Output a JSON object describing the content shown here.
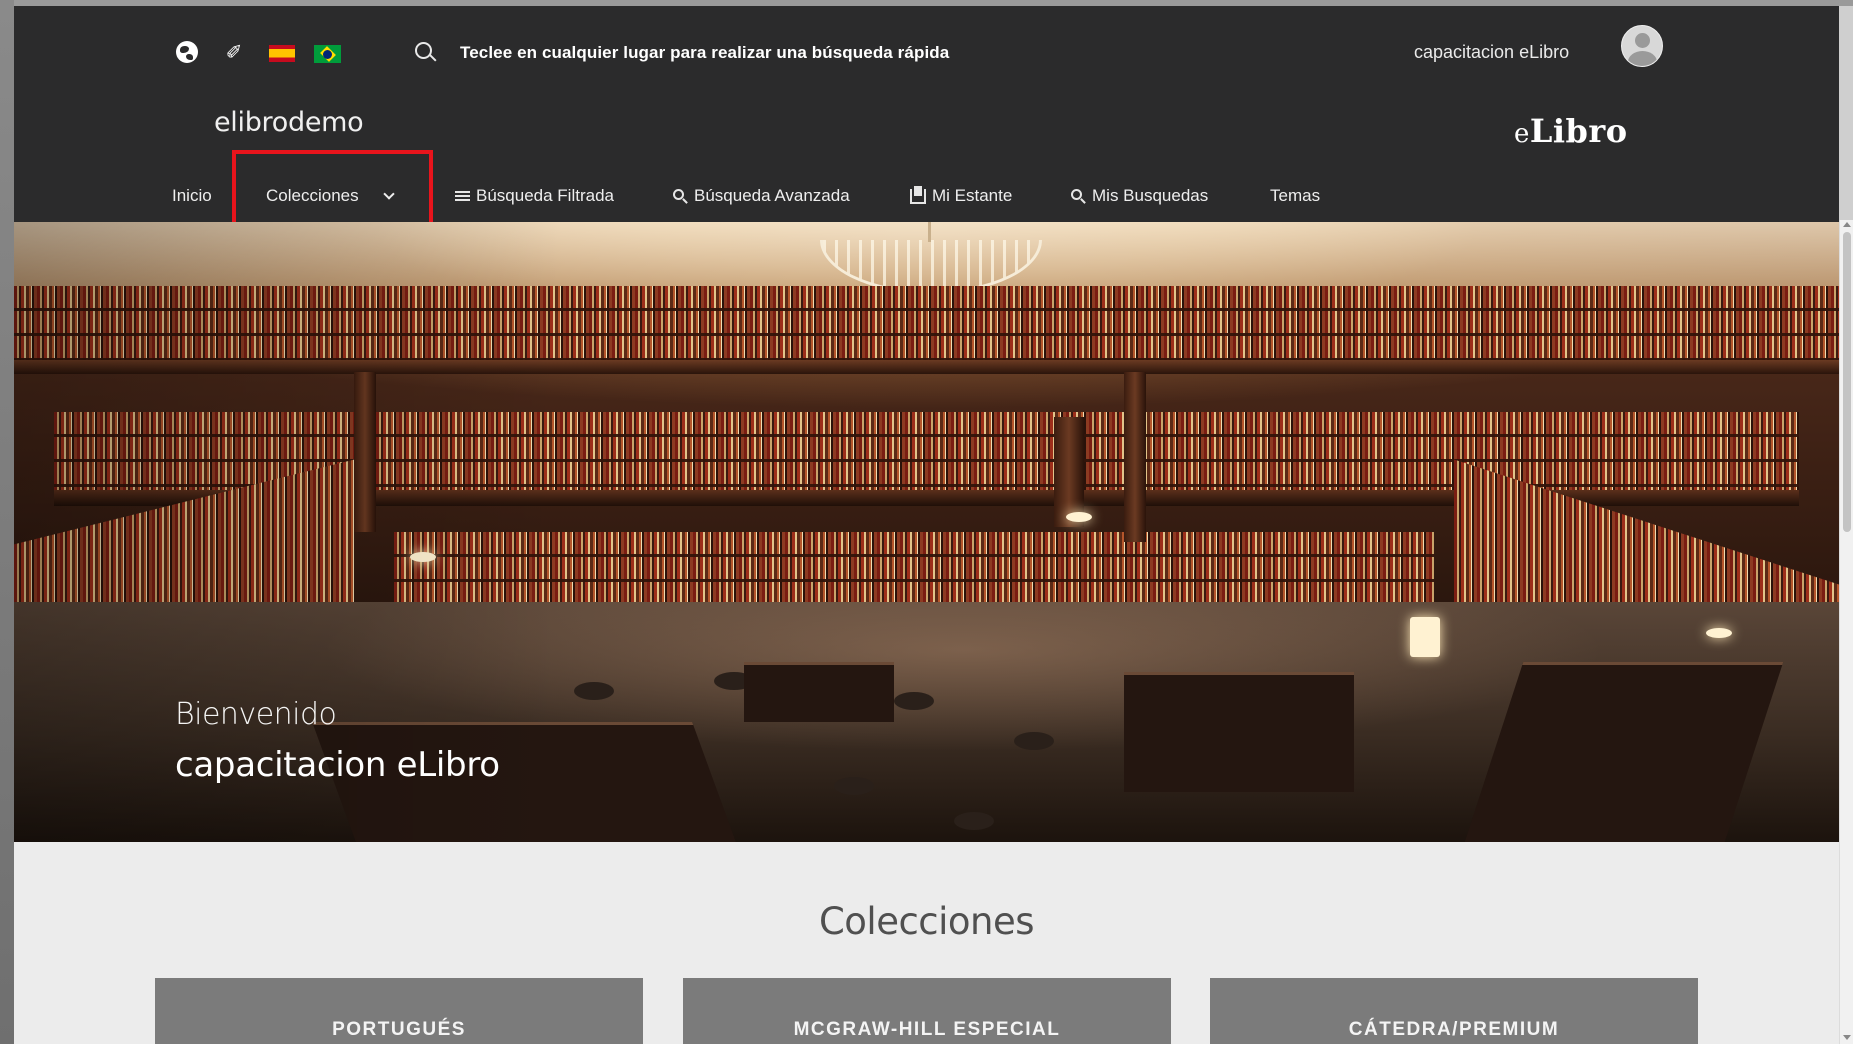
{
  "topbar": {
    "search_placeholder": "Teclee en cualquier lugar para realizar una búsqueda rápida",
    "user_name": "capacitacion eLibro",
    "icons": [
      "globe-icon",
      "link-icon",
      "flag-spain-icon",
      "flag-brazil-icon",
      "search-icon",
      "avatar-icon"
    ]
  },
  "header": {
    "site_name": "elibrodemo",
    "brand_prefix": "e",
    "brand_rest": "Libro"
  },
  "nav": {
    "inicio": "Inicio",
    "colecciones": "Colecciones",
    "busqueda_filtrada": "Búsqueda Filtrada",
    "busqueda_avanzada": "Búsqueda Avanzada",
    "mi_estante": "Mi Estante",
    "mis_busquedas": "Mis Busquedas",
    "temas": "Temas"
  },
  "hero": {
    "welcome": "Bienvenido",
    "user_name": "capacitacion eLibro"
  },
  "collections": {
    "title": "Colecciones",
    "items": [
      {
        "label": "PORTUGUÉS"
      },
      {
        "label": "MCGRAW-HILL ESPECIAL"
      },
      {
        "label": "CÁTEDRA/PREMIUM"
      }
    ]
  },
  "colors": {
    "header_bg": "#2b2b2c",
    "highlight": "#e8141c",
    "card_bg": "#7b7b7b",
    "page_bg": "#ececec"
  }
}
